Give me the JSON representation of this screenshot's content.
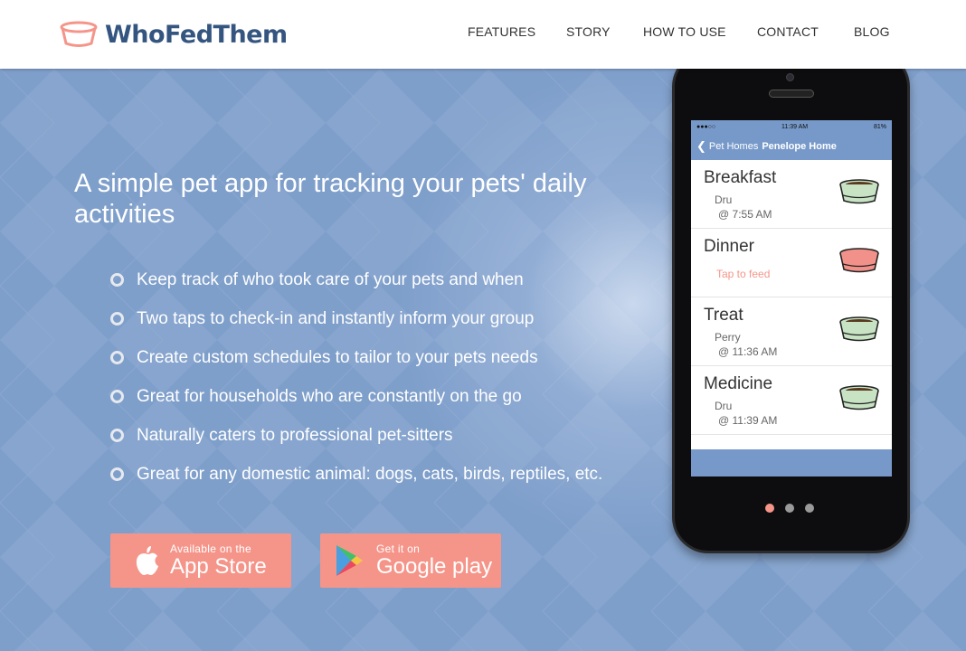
{
  "app": {
    "brand": "WhoFedThem"
  },
  "nav": {
    "items": [
      "FEATURES",
      "STORY",
      "HOW TO USE",
      "CONTACT",
      "BLOG"
    ]
  },
  "hero": {
    "headline": "A simple pet app for tracking your pets' daily activities",
    "features": [
      "Keep track of who took care of your pets and when",
      "Two taps to check-in and instantly inform your group",
      "Create custom schedules to tailor to your pets needs",
      "Great for households who are constantly on the go",
      "Naturally caters to professional pet-sitters",
      "Great for any domestic animal: dogs, cats, birds, reptiles, etc."
    ],
    "appstore": {
      "small": "Available on the",
      "big": "App Store"
    },
    "googleplay": {
      "small": "Get it on",
      "big": "Google play"
    }
  },
  "phone": {
    "status": {
      "signal": "●●●○○",
      "time": "11:39 AM",
      "battery": "81%"
    },
    "navbar": {
      "back": "Pet Homes",
      "title": "Penelope Home"
    },
    "rows": [
      {
        "title": "Breakfast",
        "by": "Dru",
        "time": "@ 7:55 AM"
      },
      {
        "title": "Dinner",
        "action": "Tap to feed"
      },
      {
        "title": "Treat",
        "by": "Perry",
        "time": "@ 11:36 AM"
      },
      {
        "title": "Medicine",
        "by": "Dru",
        "time": "@ 11:39 AM"
      }
    ]
  },
  "carousel": {
    "active_index": 0,
    "count": 3
  },
  "colors": {
    "brand": "#34557f",
    "accent": "#f5958a",
    "hero_bg": "#7f9fcb",
    "app_bar": "#7799c9",
    "bowl_fed": "#c7e3c3",
    "bowl_empty": "#f29189"
  },
  "icons": [
    "pet-bowl-logo-icon",
    "apple-icon",
    "google-play-icon",
    "back-chevron-icon",
    "food-bowl-icon"
  ]
}
